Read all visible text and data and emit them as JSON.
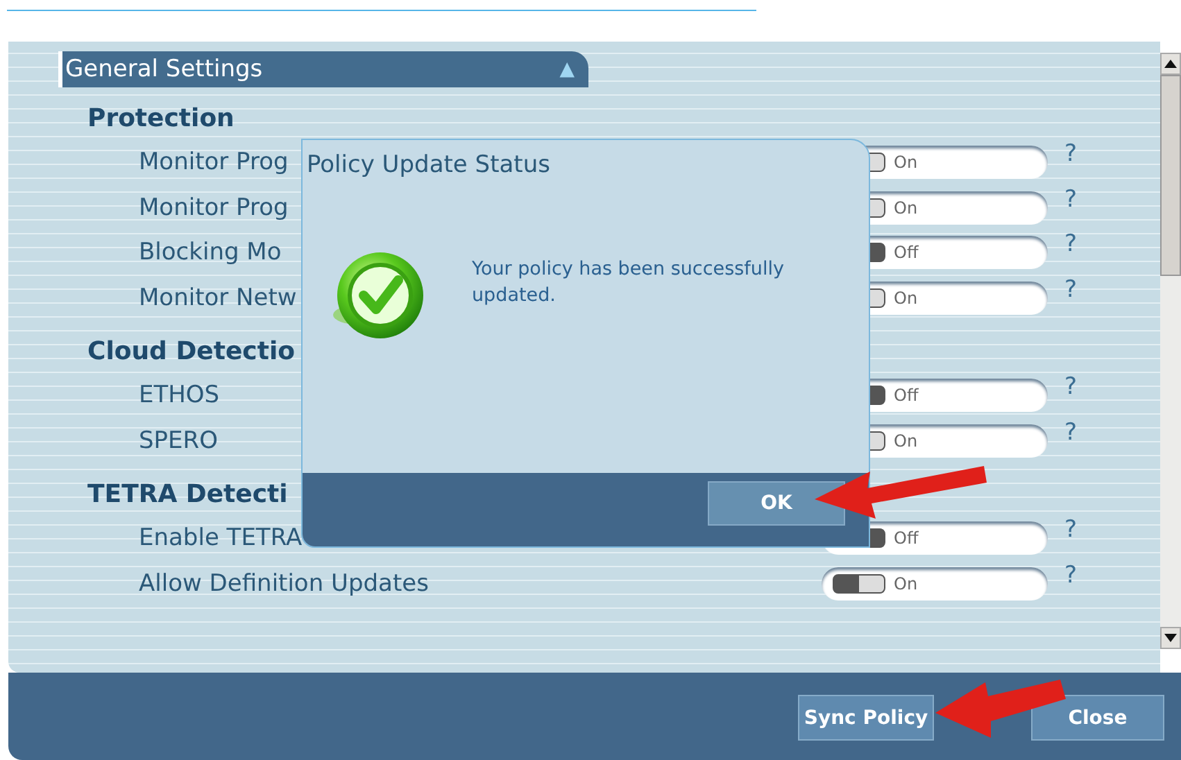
{
  "header": {
    "title": "General Settings",
    "toggle_glyph": "▲"
  },
  "sections": [
    {
      "title": "Protection",
      "rows": [
        {
          "label": "Monitor Prog",
          "on": true,
          "state_text": "On",
          "help": "?"
        },
        {
          "label": "Monitor Prog",
          "on": true,
          "state_text": "On",
          "help": "?"
        },
        {
          "label": "Blocking Mo",
          "on": false,
          "state_text": "Off",
          "help": "?"
        },
        {
          "label": "Monitor Netw",
          "on": true,
          "state_text": "On",
          "help": "?"
        }
      ]
    },
    {
      "title": "Cloud Detectio",
      "rows": [
        {
          "label": "ETHOS",
          "on": false,
          "state_text": "Off",
          "help": "?"
        },
        {
          "label": "SPERO",
          "on": true,
          "state_text": "On",
          "help": "?"
        }
      ]
    },
    {
      "title": "TETRA Detecti",
      "rows": [
        {
          "label": "Enable TETRA",
          "on": false,
          "state_text": "Off",
          "help": "?"
        },
        {
          "label": "Allow Definition Updates",
          "on": true,
          "state_text": "On",
          "help": "?"
        }
      ]
    }
  ],
  "dialog": {
    "title": "Policy Update Status",
    "message": "Your policy has been successfully updated.",
    "ok": "OK"
  },
  "buttons": [
    "Sync Policy",
    "Close"
  ]
}
